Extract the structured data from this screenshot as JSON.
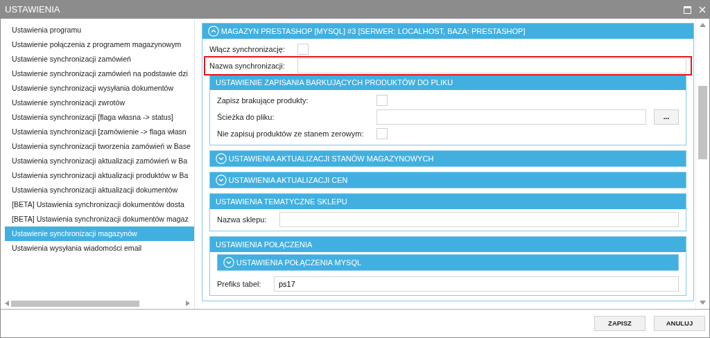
{
  "window": {
    "title": "USTAWIENIA"
  },
  "sidebar": {
    "items": [
      {
        "label": "Ustawienia programu",
        "selected": false
      },
      {
        "label": "Ustawienie połączenia z programem magazynowym",
        "selected": false
      },
      {
        "label": "Ustawienie synchronizacji zamówień",
        "selected": false
      },
      {
        "label": "Ustawienie synchronizacji zamówień na podstawie dzi",
        "selected": false
      },
      {
        "label": "Ustawienie synchronizacji wysyłania dokumentów",
        "selected": false
      },
      {
        "label": "Ustawienie synchronizacji zwrotów",
        "selected": false
      },
      {
        "label": "Ustawienia synchronizacji [flaga własna -> status]",
        "selected": false
      },
      {
        "label": "Ustawienia synchronizacji [zamówienie -> flaga własn",
        "selected": false
      },
      {
        "label": "Ustawienia synchronizacji tworzenia zamówień w Base",
        "selected": false
      },
      {
        "label": "Ustawienia synchronizacji aktualizacji zamówień w Ba",
        "selected": false
      },
      {
        "label": "Ustawienia synchronizacji aktualizacji produktów w Ba",
        "selected": false
      },
      {
        "label": "Ustawienia synchronizacji aktualizacji dokumentów",
        "selected": false
      },
      {
        "label": "[BETA] Ustawienia synchronizacji dokumentów dosta",
        "selected": false
      },
      {
        "label": "[BETA] Ustawienia synchronizacji dokumentów magaz",
        "selected": false
      },
      {
        "label": "Ustawienie synchronizacji magazynów",
        "selected": true
      },
      {
        "label": "Ustawienia wysyłania wiadomości email",
        "selected": false
      }
    ]
  },
  "panel": {
    "sections": [
      {
        "kind": "collapsible",
        "title": "MAGAZYN PRESTASHOP [MYSQL] #3 [SERWER: LOCALHOST, BAZA: PRESTASHOP]",
        "expanded": true,
        "items": [
          {
            "kind": "checkbox",
            "label": "Włącz synchronizację:",
            "checked": false
          },
          {
            "kind": "text",
            "label": "Nazwa synchronizacji:",
            "highlighted": true
          },
          {
            "kind": "section",
            "section": {
              "kind": "plain",
              "title": "USTAWIENIE ZAPISANIA BARKUJĄCYCH PRODUKTÓW DO PLIKU",
              "items": [
                {
                  "kind": "checkbox",
                  "label": "Zapisz brakujące produkty:",
                  "checked": false
                },
                {
                  "kind": "file",
                  "label": "Ścieżka do pliku:",
                  "button": "..."
                },
                {
                  "kind": "checkbox",
                  "label": "Nie zapisuj produktów ze stanem zerowym:",
                  "checked": false
                }
              ]
            }
          },
          {
            "kind": "section",
            "section": {
              "kind": "collapsible",
              "title": "USTAWIENIA AKTUALIZACJI STANÓW MAGAZYNOWYCH",
              "expanded": false
            }
          },
          {
            "kind": "section",
            "section": {
              "kind": "collapsible",
              "title": "USTAWIENIA AKTUALIZACJI CEN",
              "expanded": false
            }
          },
          {
            "kind": "section",
            "section": {
              "kind": "plain",
              "title": "USTAWIENIA TEMATYCZNE SKLEPU",
              "items": [
                {
                  "kind": "text",
                  "label": "Nazwa sklepu:",
                  "highlighted": false
                }
              ]
            }
          },
          {
            "kind": "section",
            "section": {
              "kind": "plain",
              "title": "USTAWIENIA POŁĄCZENIA",
              "items": [
                {
                  "kind": "section",
                  "section": {
                    "kind": "collapsible",
                    "title": "USTAWIENIA POŁĄCZENIA MYSQL",
                    "expanded": false
                  }
                },
                {
                  "kind": "text",
                  "label": "Prefiks tabel:",
                  "value": "ps17",
                  "highlighted": false
                }
              ]
            }
          }
        ]
      }
    ]
  },
  "buttons": [
    {
      "label": "ZAPISZ"
    },
    {
      "label": "ANULUJ"
    }
  ]
}
